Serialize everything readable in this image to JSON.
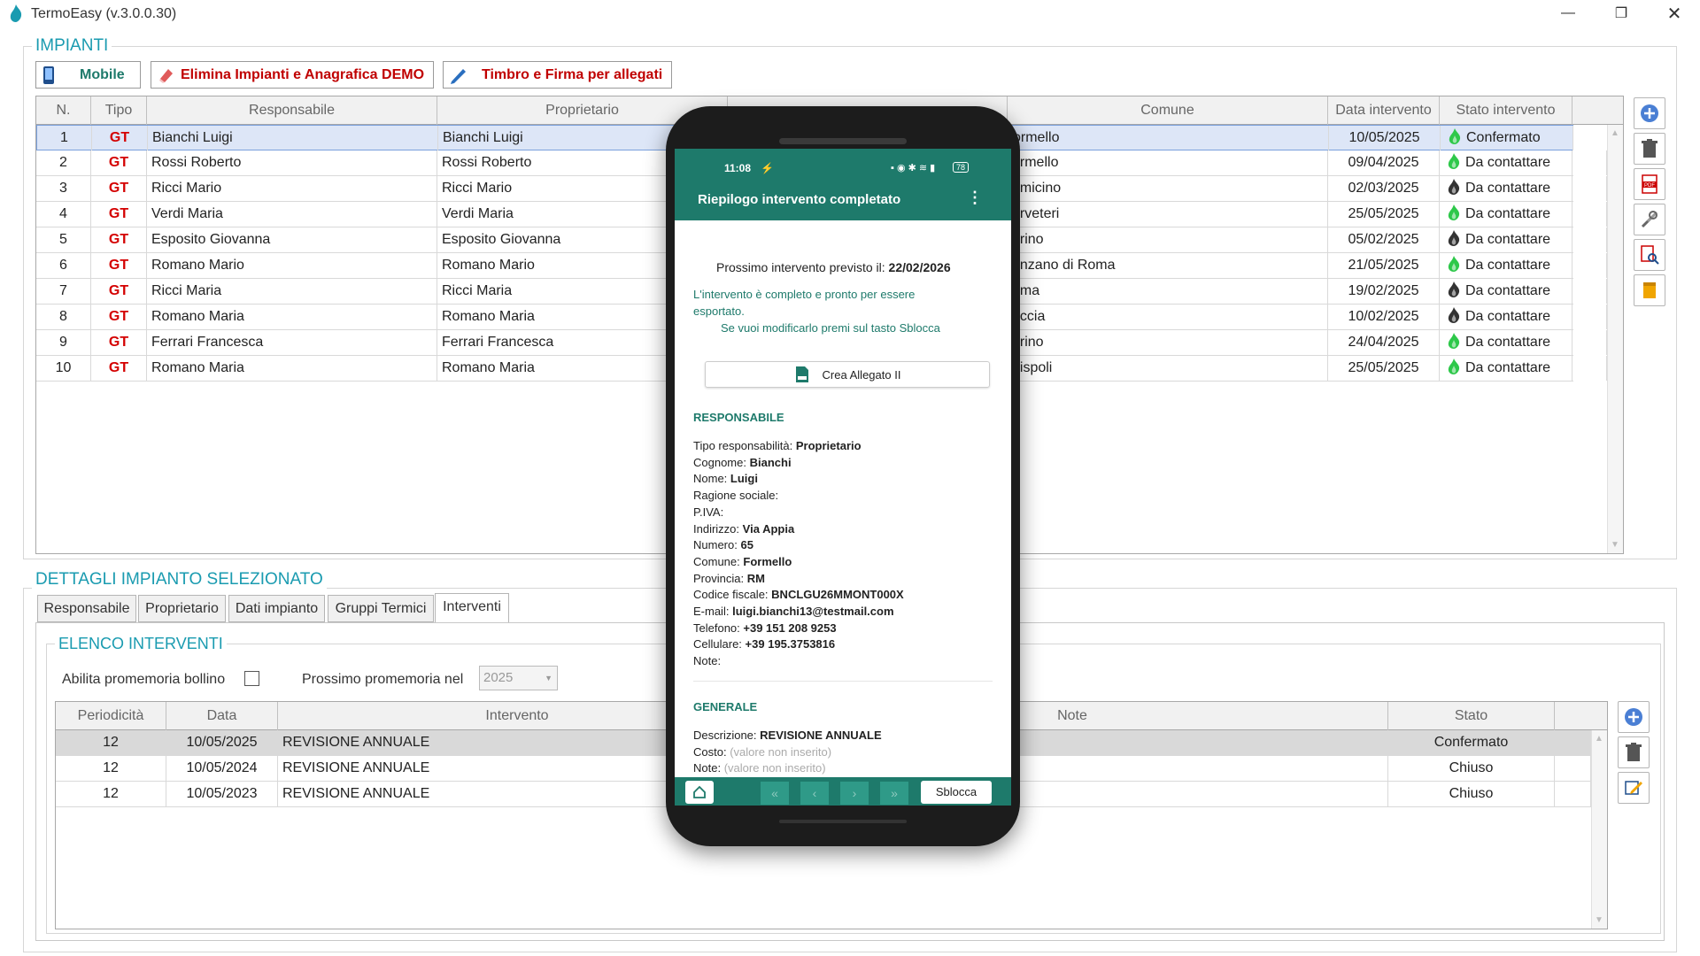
{
  "window": {
    "title": "TermoEasy (v.3.0.0.30)"
  },
  "impianti": {
    "section_title": "IMPIANTI",
    "toolbar": {
      "mobile": "Mobile",
      "elimina": "Elimina Impianti e Anagrafica DEMO",
      "timbro": "Timbro e Firma per allegati"
    },
    "columns": [
      "N.",
      "Tipo",
      "Responsabile",
      "Proprietario",
      "",
      "Comune",
      "Data intervento",
      "Stato intervento"
    ],
    "rows": [
      {
        "n": "1",
        "tipo": "GT",
        "resp": "Bianchi Luigi",
        "prop": "Bianchi Luigi",
        "comune": "ormello",
        "data": "10/05/2025",
        "stato": "Confermato",
        "flame": "green"
      },
      {
        "n": "2",
        "tipo": "GT",
        "resp": "Rossi Roberto",
        "prop": "Rossi Roberto",
        "comune": "ormello",
        "data": "09/04/2025",
        "stato": "Da contattare",
        "flame": "green"
      },
      {
        "n": "3",
        "tipo": "GT",
        "resp": "Ricci Mario",
        "prop": "Ricci Mario",
        "comune": "umicino",
        "data": "02/03/2025",
        "stato": "Da contattare",
        "flame": "black"
      },
      {
        "n": "4",
        "tipo": "GT",
        "resp": "Verdi Maria",
        "prop": "Verdi Maria",
        "comune": "erveteri",
        "data": "25/05/2025",
        "stato": "Da contattare",
        "flame": "green"
      },
      {
        "n": "5",
        "tipo": "GT",
        "resp": "Esposito Giovanna",
        "prop": "Esposito Giovanna",
        "comune": "arino",
        "data": "05/02/2025",
        "stato": "Da contattare",
        "flame": "black"
      },
      {
        "n": "6",
        "tipo": "GT",
        "resp": "Romano Mario",
        "prop": "Romano Mario",
        "comune": "enzano di Roma",
        "data": "21/05/2025",
        "stato": "Da contattare",
        "flame": "green"
      },
      {
        "n": "7",
        "tipo": "GT",
        "resp": "Ricci Maria",
        "prop": "Ricci Maria",
        "comune": "oma",
        "data": "19/02/2025",
        "stato": "Da contattare",
        "flame": "black"
      },
      {
        "n": "8",
        "tipo": "GT",
        "resp": "Romano Maria",
        "prop": "Romano Maria",
        "comune": "riccia",
        "data": "10/02/2025",
        "stato": "Da contattare",
        "flame": "black"
      },
      {
        "n": "9",
        "tipo": "GT",
        "resp": "Ferrari Francesca",
        "prop": "Ferrari Francesca",
        "comune": "arino",
        "data": "24/04/2025",
        "stato": "Da contattare",
        "flame": "green"
      },
      {
        "n": "10",
        "tipo": "GT",
        "resp": "Romano Maria",
        "prop": "Romano Maria",
        "comune": "dispoli",
        "data": "25/05/2025",
        "stato": "Da contattare",
        "flame": "green"
      }
    ]
  },
  "dettagli": {
    "section_title": "DETTAGLI IMPIANTO SELEZIONATO",
    "tabs": [
      "Responsabile",
      "Proprietario",
      "Dati impianto",
      "Gruppi Termici",
      "Interventi"
    ],
    "elenco_title": "ELENCO INTERVENTI",
    "abilita_label": "Abilita promemoria bollino",
    "prossimo_label": "Prossimo promemoria nel",
    "year_value": "2025",
    "columns": [
      "Periodicità",
      "Data",
      "Intervento",
      "Note",
      "Stato"
    ],
    "rows": [
      {
        "per": "12",
        "data": "10/05/2025",
        "intervento": "REVISIONE ANNUALE",
        "stato": "Confermato"
      },
      {
        "per": "12",
        "data": "10/05/2024",
        "intervento": "REVISIONE ANNUALE",
        "stato": "Chiuso"
      },
      {
        "per": "12",
        "data": "10/05/2023",
        "intervento": "REVISIONE ANNUALE",
        "stato": "Chiuso"
      }
    ]
  },
  "phone": {
    "time": "11:08",
    "battery": "78",
    "title": "Riepilogo intervento completato",
    "prossimo_label": "Prossimo intervento previsto il:",
    "prossimo_date": "22/02/2026",
    "msg1": "L'intervento è completo e pronto per essere",
    "msg2": "esportato.",
    "msg3": "Se vuoi modificarlo premi sul tasto Sblocca",
    "crea_button": "Crea Allegato II",
    "resp_title": "RESPONSABILE",
    "resp_fields": [
      {
        "k": "Tipo responsabilità:",
        "v": "Proprietario"
      },
      {
        "k": "Cognome:",
        "v": "Bianchi"
      },
      {
        "k": "Nome:",
        "v": "Luigi"
      },
      {
        "k": "Ragione sociale:",
        "v": ""
      },
      {
        "k": "P.IVA:",
        "v": ""
      },
      {
        "k": "Indirizzo:",
        "v": "Via Appia"
      },
      {
        "k": "Numero:",
        "v": "65"
      },
      {
        "k": "Comune:",
        "v": "Formello"
      },
      {
        "k": "Provincia:",
        "v": "RM"
      },
      {
        "k": "Codice fiscale:",
        "v": "BNCLGU26MMONT000X"
      },
      {
        "k": "E-mail:",
        "v": "luigi.bianchi13@testmail.com"
      },
      {
        "k": "Telefono:",
        "v": "+39 151 208 9253"
      },
      {
        "k": "Cellulare:",
        "v": "+39 195.3753816"
      },
      {
        "k": "Note:",
        "v": ""
      }
    ],
    "gen_title": "GENERALE",
    "gen_fields": [
      {
        "k": "Descrizione:",
        "v": "REVISIONE ANNUALE",
        "placeholder": false
      },
      {
        "k": "Costo:",
        "v": "(valore non inserito)",
        "placeholder": true
      },
      {
        "k": "Note:",
        "v": "(valore non inserito)",
        "placeholder": true
      }
    ],
    "sblocca": "Sblocca"
  },
  "colors": {
    "accent": "#1a9bb0",
    "phone_teal": "#1e7a6b",
    "gt_red": "#d40000",
    "flame_green": "#2ec84a",
    "flame_black": "#333333",
    "selection": "#dde6f7"
  }
}
